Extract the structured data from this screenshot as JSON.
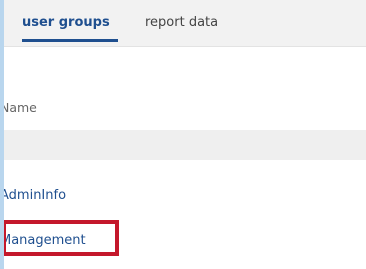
{
  "tabs": {
    "active_label": "user groups",
    "inactive_label": "report data"
  },
  "table": {
    "column_header": "Name",
    "rows": [
      {
        "label": "AdminInfo"
      },
      {
        "label": "Management"
      }
    ]
  },
  "colors": {
    "link": "#1f4f8f",
    "highlight": "#c4182b",
    "frame": "#b9d6ee"
  }
}
